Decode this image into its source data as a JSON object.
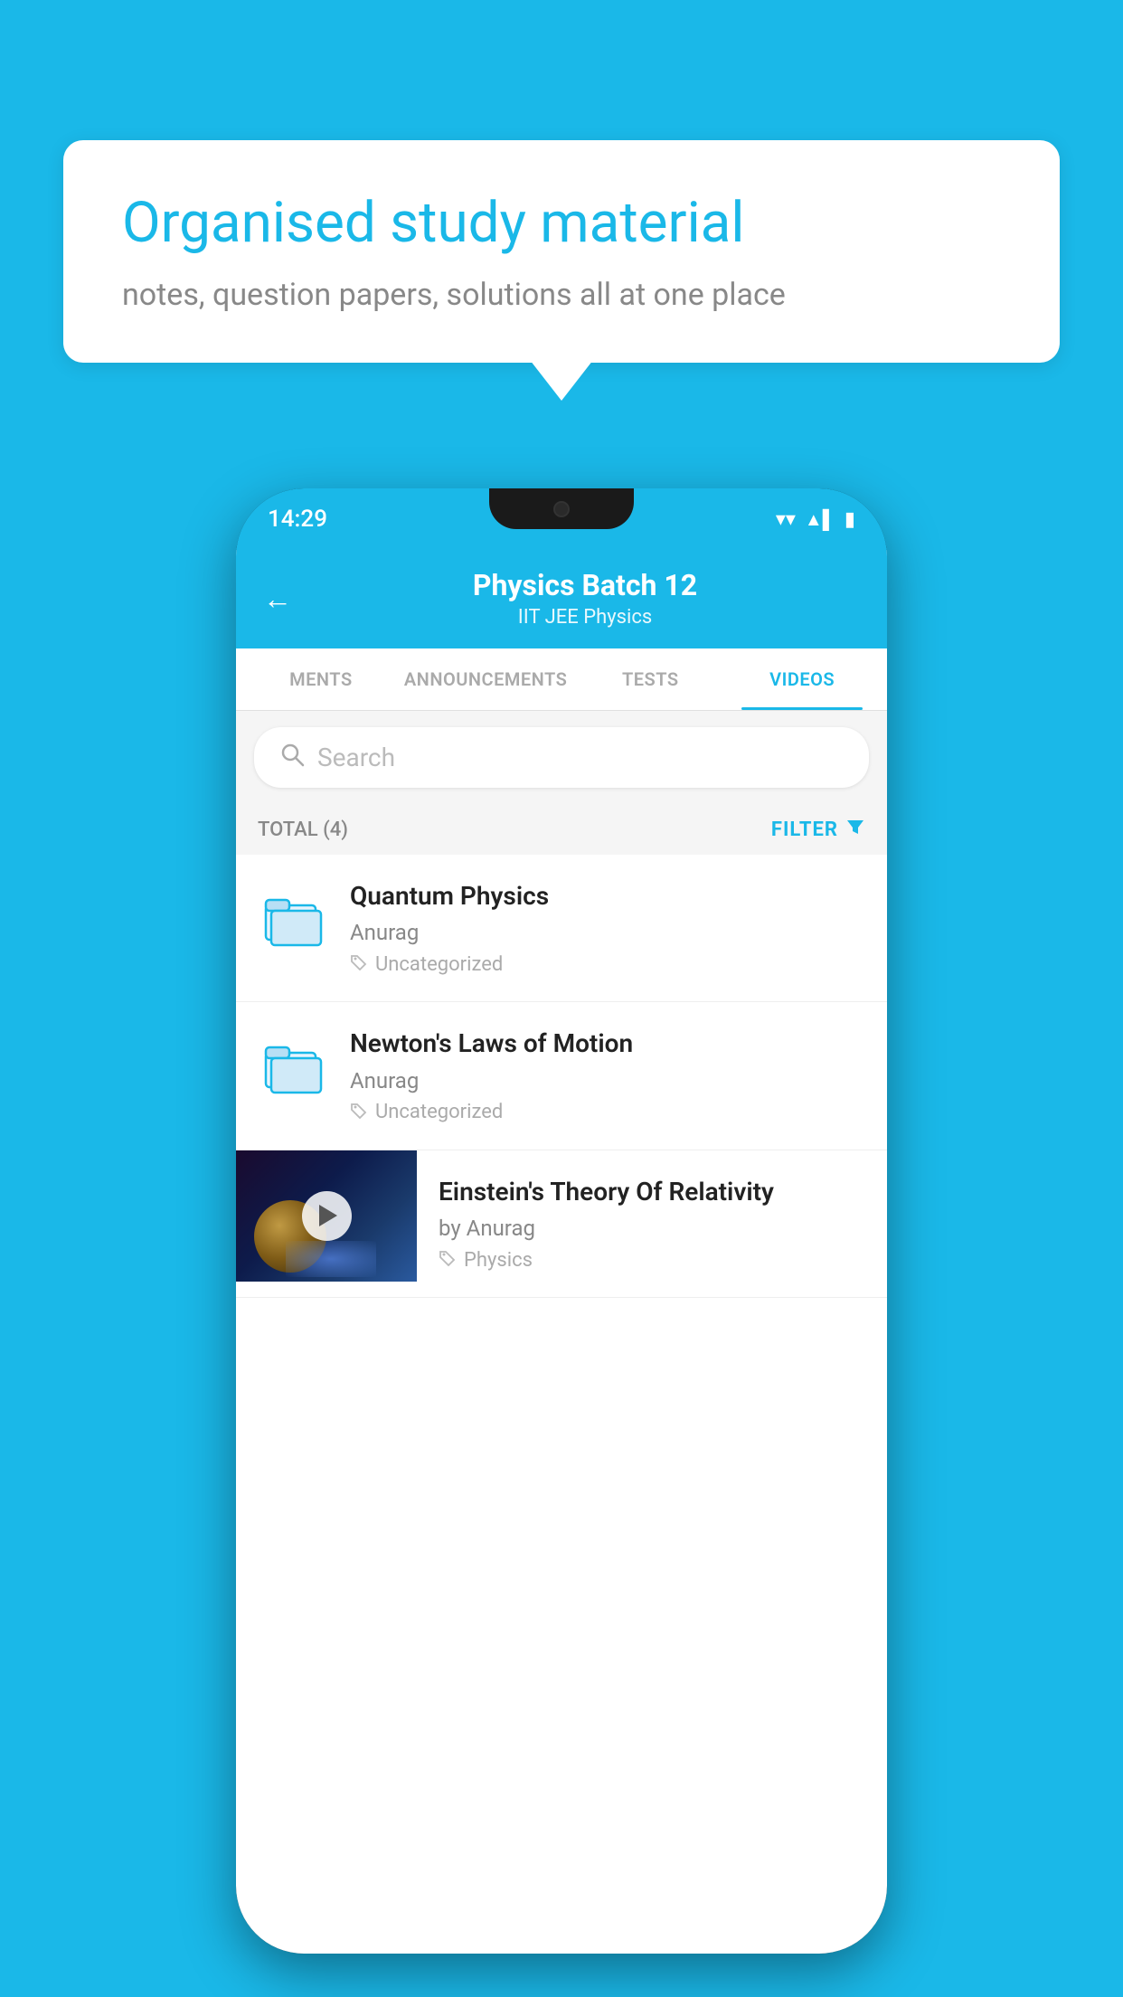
{
  "background_color": "#1ab8e8",
  "speech_bubble": {
    "title": "Organised study material",
    "subtitle": "notes, question papers, solutions all at one place"
  },
  "phone": {
    "status_bar": {
      "time": "14:29",
      "wifi": "▼",
      "signal": "▲",
      "battery": "▌"
    },
    "header": {
      "back_label": "←",
      "title": "Physics Batch 12",
      "subtitle": "IIT JEE   Physics"
    },
    "tabs": [
      {
        "label": "MENTS",
        "active": false
      },
      {
        "label": "ANNOUNCEMENTS",
        "active": false
      },
      {
        "label": "TESTS",
        "active": false
      },
      {
        "label": "VIDEOS",
        "active": true
      }
    ],
    "search": {
      "placeholder": "Search"
    },
    "filter": {
      "total_label": "TOTAL (4)",
      "filter_label": "FILTER"
    },
    "videos": [
      {
        "title": "Quantum Physics",
        "author": "Anurag",
        "tag": "Uncategorized",
        "type": "folder"
      },
      {
        "title": "Newton's Laws of Motion",
        "author": "Anurag",
        "tag": "Uncategorized",
        "type": "folder"
      },
      {
        "title": "Einstein's Theory Of Relativity",
        "author": "by Anurag",
        "tag": "Physics",
        "type": "video"
      }
    ]
  }
}
